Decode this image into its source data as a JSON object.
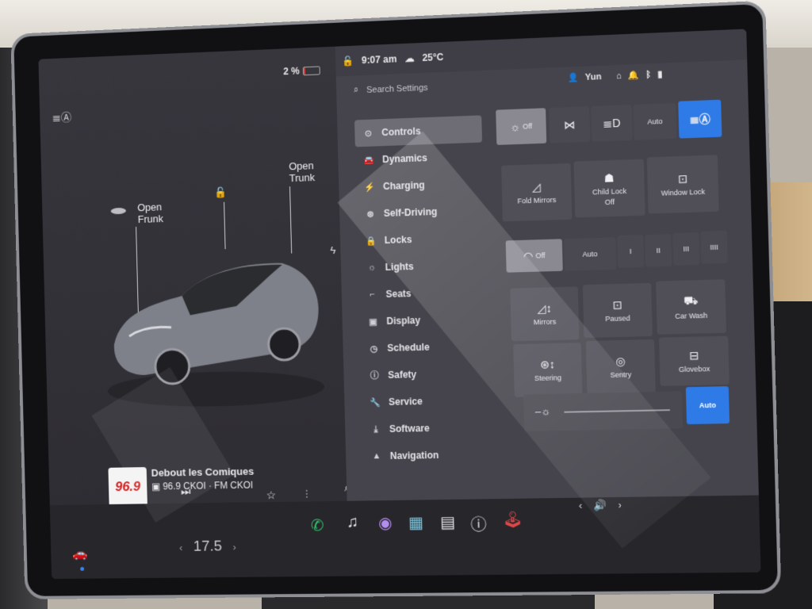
{
  "status": {
    "battery_percent_text": "2 %",
    "battery_level": 0.1,
    "time": "9:07 am",
    "temperature": "25°C"
  },
  "car": {
    "frunk_line1": "Open",
    "frunk_line2": "Frunk",
    "trunk_line1": "Open",
    "trunk_line2": "Trunk",
    "body_color": "#7e8189"
  },
  "media": {
    "logo_text": "96.9",
    "title": "Debout les Comiques",
    "station": "96.9 CKOI · FM CKOI"
  },
  "settings": {
    "search_placeholder": "Search Settings",
    "user_name": "Yun",
    "nav": [
      {
        "label": "Controls",
        "icon": "toggle-icon",
        "glyph": "⊙"
      },
      {
        "label": "Dynamics",
        "icon": "car-icon",
        "glyph": "🚘"
      },
      {
        "label": "Charging",
        "icon": "bolt-icon",
        "glyph": "⚡"
      },
      {
        "label": "Self-Driving",
        "icon": "steering-wheel-icon",
        "glyph": "⊛"
      },
      {
        "label": "Locks",
        "icon": "lock-icon",
        "glyph": "🔒"
      },
      {
        "label": "Lights",
        "icon": "sun-icon",
        "glyph": "☼"
      },
      {
        "label": "Seats",
        "icon": "seat-icon",
        "glyph": "⌐"
      },
      {
        "label": "Display",
        "icon": "display-icon",
        "glyph": "▣"
      },
      {
        "label": "Schedule",
        "icon": "clock-icon",
        "glyph": "◷"
      },
      {
        "label": "Safety",
        "icon": "info-icon",
        "glyph": "ⓘ"
      },
      {
        "label": "Service",
        "icon": "wrench-icon",
        "glyph": "🔧"
      },
      {
        "label": "Software",
        "icon": "download-icon",
        "glyph": "⤓"
      },
      {
        "label": "Navigation",
        "icon": "navigation-icon",
        "glyph": "▲"
      }
    ],
    "lights_row": {
      "off": "Off",
      "auto": "Auto"
    },
    "mirrors_row": {
      "fold_mirrors": "Fold Mirrors",
      "child_lock": "Child Lock",
      "child_lock_state": "Off",
      "window_lock": "Window Lock"
    },
    "wipers_row": {
      "off": "Off",
      "auto": "Auto",
      "speeds": [
        "I",
        "II",
        "III",
        "IIII"
      ]
    },
    "tiles": {
      "mirrors": "Mirrors",
      "paused": "Paused",
      "car_wash": "Car Wash",
      "steering": "Steering",
      "sentry": "Sentry",
      "glovebox": "Glovebox",
      "auto": "Auto"
    }
  },
  "taskbar": {
    "cabin_temp": "17.5"
  },
  "colors": {
    "accent": "#2e7ae6",
    "battery_low": "#e23b3b"
  }
}
